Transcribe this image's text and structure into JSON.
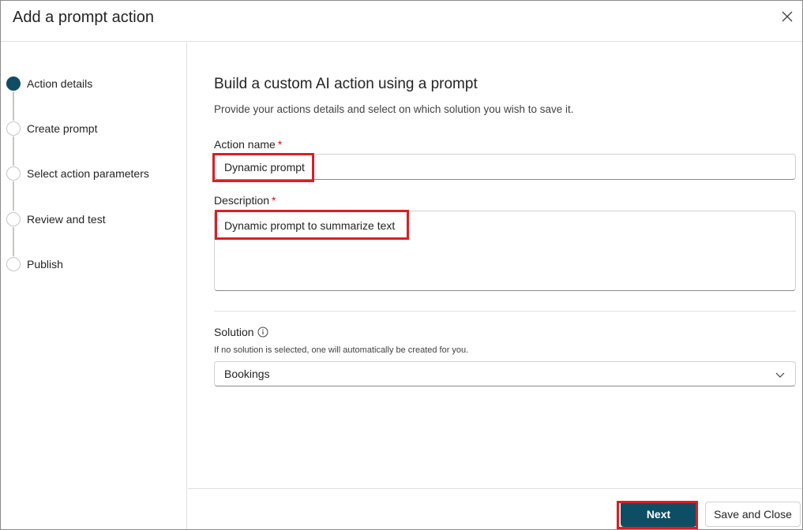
{
  "dialog": {
    "title": "Add a prompt action"
  },
  "stepper": {
    "steps": [
      {
        "label": "Action details",
        "state": "active"
      },
      {
        "label": "Create prompt",
        "state": "pending"
      },
      {
        "label": "Select action parameters",
        "state": "pending"
      },
      {
        "label": "Review and test",
        "state": "pending"
      },
      {
        "label": "Publish",
        "state": "pending"
      }
    ]
  },
  "form": {
    "heading": "Build a custom AI action using a prompt",
    "subtext": "Provide your actions details and select on which solution you wish to save it.",
    "action_name": {
      "label": "Action name",
      "required_mark": "*",
      "value": "Dynamic prompt"
    },
    "description": {
      "label": "Description",
      "required_mark": "*",
      "value": "Dynamic prompt to summarize text"
    },
    "solution": {
      "label": "Solution",
      "hint": "If no solution is selected, one will automatically be created for you.",
      "selected": "Bookings"
    }
  },
  "footer": {
    "next_label": "Next",
    "save_close_label": "Save and Close"
  },
  "colors": {
    "accent": "#0e4e64",
    "highlight": "#d91e26",
    "required": "#c50f1f"
  },
  "icons": {
    "close": "close-icon",
    "info": "info-icon",
    "chevron": "chevron-down-icon"
  }
}
